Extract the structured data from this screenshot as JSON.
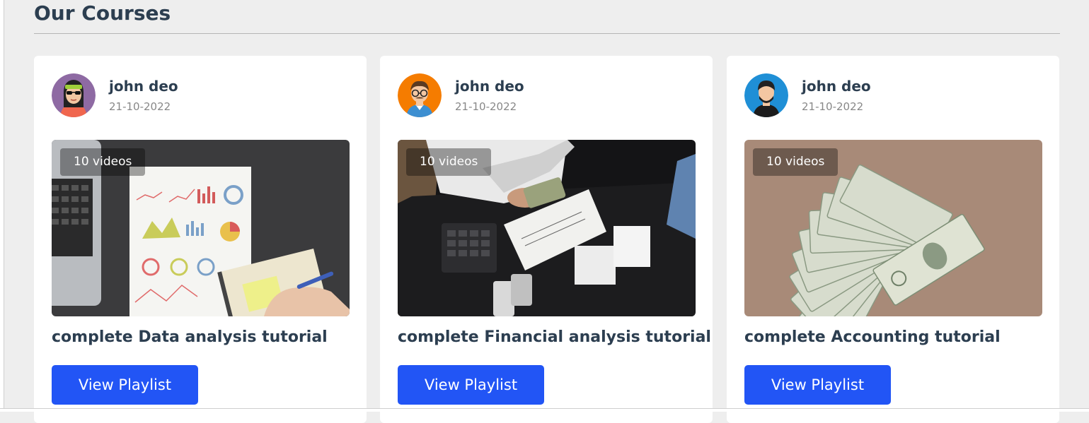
{
  "section": {
    "title": "Our Courses"
  },
  "courses": [
    {
      "author": "john deo",
      "date": "21-10-2022",
      "badge": "10 videos",
      "title": "complete Data analysis tutorial",
      "button_label": "View Playlist",
      "avatar_icon": "woman-sunglasses-avatar-icon",
      "thumbnail_icon": "data-charts-laptop-image"
    },
    {
      "author": "john deo",
      "date": "21-10-2022",
      "badge": "10 videos",
      "title": "complete Financial analysis tutorial",
      "button_label": "View Playlist",
      "avatar_icon": "man-glasses-avatar-icon",
      "thumbnail_icon": "counting-money-desk-image"
    },
    {
      "author": "john deo",
      "date": "21-10-2022",
      "badge": "10 videos",
      "title": "complete Accounting tutorial",
      "button_label": "View Playlist",
      "avatar_icon": "man-avatar-icon",
      "thumbnail_icon": "dollar-bills-fan-image"
    }
  ],
  "colors": {
    "accent": "#2255f5",
    "background": "#eeeeee",
    "card": "#ffffff",
    "heading": "#2c3e50"
  }
}
